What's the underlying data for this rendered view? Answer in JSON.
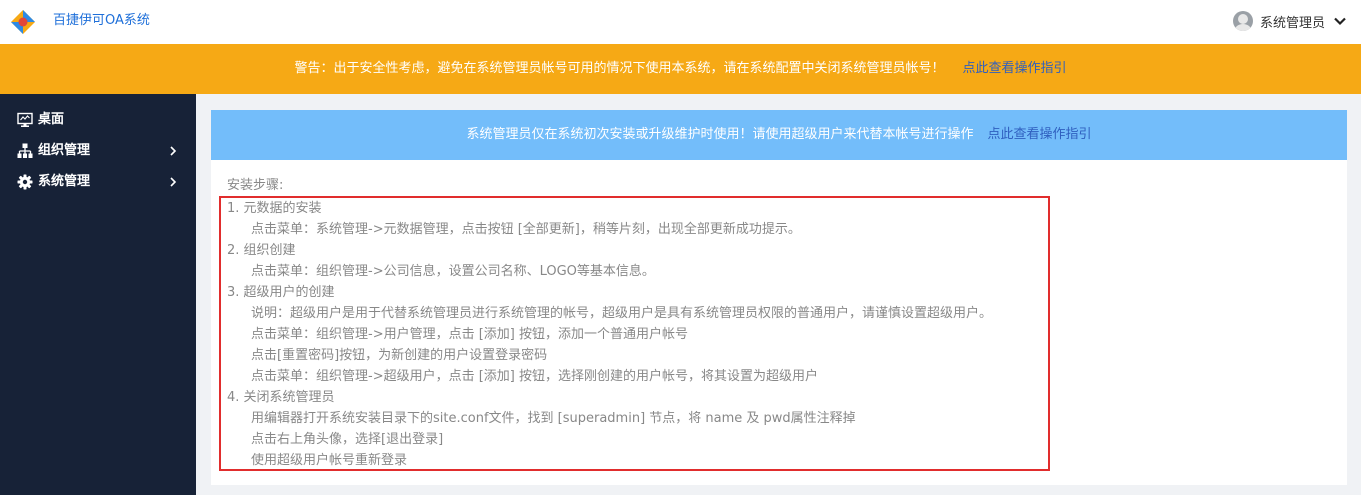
{
  "header": {
    "app_title": "百捷伊可OA系统",
    "user_name": "系统管理员"
  },
  "warning": {
    "text": "警告：出于安全性考虑，避免在系统管理员帐号可用的情况下使用本系统，请在系统配置中关闭系统管理员帐号！",
    "link": "点此查看操作指引"
  },
  "sidebar": {
    "items": [
      {
        "label": "桌面",
        "icon": "desktop-icon"
      },
      {
        "label": "组织管理",
        "icon": "org-chart-icon"
      },
      {
        "label": "系统管理",
        "icon": "gear-icon"
      }
    ]
  },
  "info": {
    "text": "系统管理员仅在系统初次安装或升级维护时使用！请使用超级用户来代替本帐号进行操作",
    "link": "点此查看操作指引"
  },
  "steps": {
    "title": "安装步骤:",
    "lines": [
      "1. 元数据的安装",
      "点击菜单：系统管理->元数据管理，点击按钮 [全部更新]，稍等片刻，出现全部更新成功提示。",
      "2. 组织创建",
      "点击菜单：组织管理->公司信息，设置公司名称、LOGO等基本信息。",
      "3. 超级用户的创建",
      "说明：超级用户是用于代替系统管理员进行系统管理的帐号，超级用户是具有系统管理员权限的普通用户，请谨慎设置超级用户。",
      "点击菜单：组织管理->用户管理，点击 [添加] 按钮，添加一个普通用户帐号",
      "点击[重置密码]按钮，为新创建的用户设置登录密码",
      "点击菜单：组织管理->超级用户，点击 [添加] 按钮，选择刚创建的用户帐号，将其设置为超级用户",
      "4. 关闭系统管理员",
      "用编辑器打开系统安装目录下的site.conf文件，找到 [superadmin] 节点，将 name 及 pwd属性注释掉",
      "点击右上角头像，选择[退出登录]",
      "使用超级用户帐号重新登录"
    ]
  },
  "colors": {
    "warning_bg": "#f6a915",
    "info_bg": "#73bdfa",
    "sidebar_bg": "#172237",
    "highlight_border": "#e12d2d",
    "link": "#2f5fbf"
  }
}
